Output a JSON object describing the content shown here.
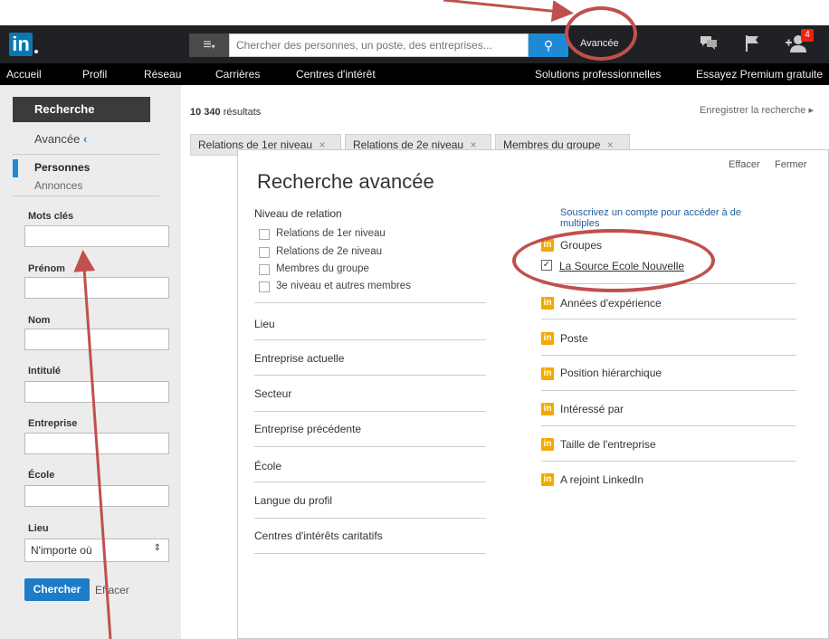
{
  "header": {
    "logo": "in",
    "search_placeholder": "Chercher des personnes, un poste, des entreprises...",
    "advanced": "Avancée",
    "notification_count": "4"
  },
  "nav": {
    "items": [
      "Accueil",
      "Profil",
      "Réseau",
      "Carrières",
      "Centres d'intérêt",
      "Solutions professionnelles",
      "Essayez Premium gratuite"
    ]
  },
  "sidebar": {
    "title": "Recherche",
    "avancee": "Avancée",
    "avancee_chevron": "‹",
    "tab_personnes": "Personnes",
    "tab_annonces": "Annonces",
    "fields": {
      "mots_cles": "Mots clés",
      "prenom": "Prénom",
      "nom": "Nom",
      "intitule": "Intitulé",
      "entreprise": "Entreprise",
      "ecole": "École",
      "lieu": "Lieu"
    },
    "lieu_value": "N'importe où",
    "chercher": "Chercher",
    "effacer": "Effacer"
  },
  "results": {
    "count": "10 340",
    "count_suffix": "résultats",
    "save_search": "Enregistrer la recherche",
    "chips": [
      "Relations de 1er niveau",
      "Relations de 2e niveau",
      "Membres du groupe"
    ]
  },
  "modal": {
    "title": "Recherche avancée",
    "effacer": "Effacer",
    "fermer": "Fermer",
    "relation_title": "Niveau de relation",
    "relations": [
      "Relations de 1er niveau",
      "Relations de 2e niveau",
      "Membres du groupe",
      "3e niveau et autres membres"
    ],
    "sections": [
      "Lieu",
      "Entreprise actuelle",
      "Secteur",
      "Entreprise précédente",
      "École",
      "Langue du profil",
      "Centres d'intérêts caritatifs"
    ],
    "upgrade_text": "Souscrivez un compte pour accéder à de multiples",
    "groupes": "Groupes",
    "group_checked": "La Source Ecole Nouvelle",
    "premium_filters": [
      "Années d'expérience",
      "Poste",
      "Position hiérarchique",
      "Intéressé par",
      "Taille de l'entreprise",
      "A rejoint LinkedIn"
    ]
  },
  "colors": {
    "accent": "#1e8ad6",
    "annotation": "#c0504d",
    "premium": "#f2a900"
  }
}
